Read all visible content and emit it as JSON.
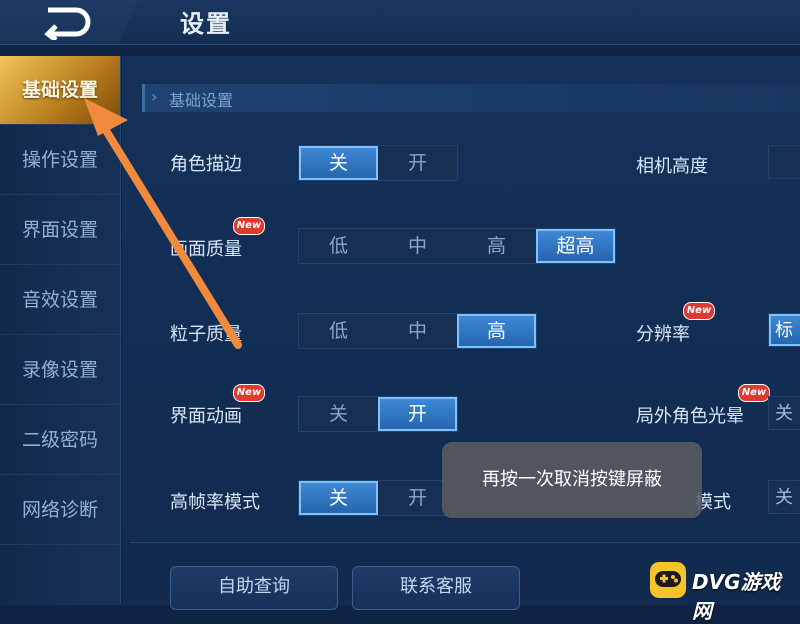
{
  "header": {
    "title": "设置"
  },
  "sidebar": {
    "items": [
      {
        "label": "基础设置",
        "active": true
      },
      {
        "label": "操作设置"
      },
      {
        "label": "界面设置"
      },
      {
        "label": "音效设置"
      },
      {
        "label": "录像设置"
      },
      {
        "label": "二级密码"
      },
      {
        "label": "网络诊断"
      }
    ]
  },
  "section": {
    "title": "基础设置"
  },
  "settings": {
    "outline": {
      "label": "角色描边",
      "options": [
        "关",
        "开"
      ],
      "selected": "关"
    },
    "quality": {
      "label": "画面质量",
      "badge": "New",
      "options": [
        "低",
        "中",
        "高",
        "超高"
      ],
      "selected": "超高"
    },
    "particle": {
      "label": "粒子质量",
      "options": [
        "低",
        "中",
        "高"
      ],
      "selected": "高"
    },
    "ui_anim": {
      "label": "界面动画",
      "badge": "New",
      "options": [
        "关",
        "开"
      ],
      "selected": "开"
    },
    "high_fps": {
      "label": "高帧率模式",
      "options": [
        "关",
        "开"
      ],
      "selected": "关"
    },
    "camera_height": {
      "label": "相机高度",
      "value": ""
    },
    "resolution": {
      "label": "分辨率",
      "badge": "New",
      "value": "标"
    },
    "outer_glow": {
      "label": "局外角色光晕",
      "badge": "New",
      "value": "关"
    },
    "mode_partial": {
      "label": "模式",
      "value": "关"
    }
  },
  "toast": {
    "text": "再按一次取消按键屏蔽"
  },
  "buttons": {
    "self_help": "自助查询",
    "contact": "联系客服"
  },
  "watermark": {
    "text": "DVG游戏网"
  },
  "colors": {
    "accent": "#2f78c8",
    "active_tab": "#d89a2e",
    "arrow": "#f08a3c",
    "badge": "#e0392f"
  }
}
